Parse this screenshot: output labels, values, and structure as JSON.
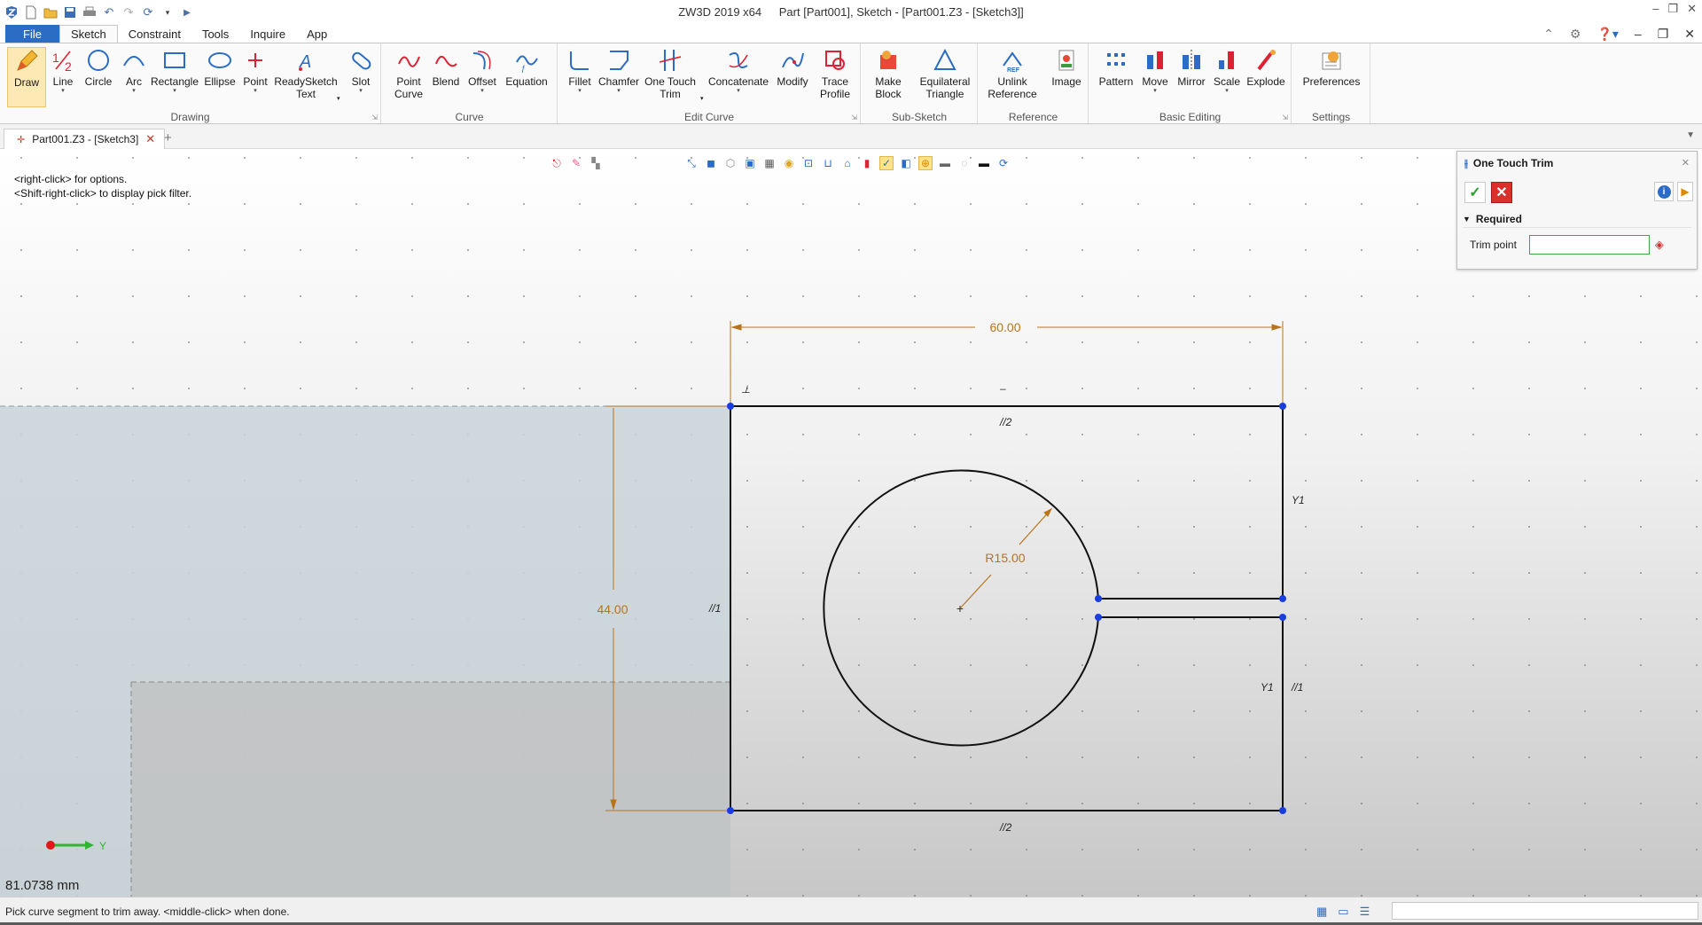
{
  "window": {
    "app_title": "ZW3D 2019  x64",
    "doc_title": "Part [Part001],  Sketch - [Part001.Z3 - [Sketch3]]"
  },
  "menu": {
    "file": "File",
    "tabs": [
      "Sketch",
      "Constraint",
      "Tools",
      "Inquire",
      "App"
    ]
  },
  "ribbon": {
    "groups": {
      "drawing": "Drawing",
      "curve": "Curve",
      "edit_curve": "Edit Curve",
      "sub_sketch": "Sub-Sketch",
      "reference": "Reference",
      "basic_editing": "Basic Editing",
      "settings": "Settings"
    },
    "buttons": {
      "draw": "Draw",
      "line": "Line",
      "circle": "Circle",
      "arc": "Arc",
      "rectangle": "Rectangle",
      "ellipse": "Ellipse",
      "point": "Point",
      "readysketch_1": "ReadySketch",
      "readysketch_2": "Text",
      "slot": "Slot",
      "point_curve_1": "Point",
      "point_curve_2": "Curve",
      "blend": "Blend",
      "offset": "Offset",
      "equation": "Equation",
      "fillet": "Fillet",
      "chamfer": "Chamfer",
      "one_touch_trim_1": "One Touch",
      "one_touch_trim_2": "Trim",
      "concatenate": "Concatenate",
      "modify": "Modify",
      "trace_profile_1": "Trace",
      "trace_profile_2": "Profile",
      "make_block_1": "Make",
      "make_block_2": "Block",
      "eq_triangle_1": "Equilateral",
      "eq_triangle_2": "Triangle",
      "unlink_ref_1": "Unlink",
      "unlink_ref_2": "Reference",
      "image": "Image",
      "pattern": "Pattern",
      "move": "Move",
      "mirror": "Mirror",
      "scale": "Scale",
      "explode": "Explode",
      "preferences": "Preferences"
    }
  },
  "doc_tab": {
    "label": "Part001.Z3 - [Sketch3]"
  },
  "viewport": {
    "hint_line1": "<right-click> for options.",
    "hint_line2": "<Shift-right-click> to display pick filter.",
    "readout": "81.0738 mm",
    "dim_width": "60.00",
    "dim_height": "44.00",
    "dim_radius": "R15.00",
    "axis_label": "Y",
    "constraint_parallel_1": "//1",
    "constraint_parallel_2": "//2",
    "constraint_tangent_1": "Y1"
  },
  "command_panel": {
    "title": "One Touch Trim",
    "section": "Required",
    "field_label": "Trim point",
    "field_value": ""
  },
  "status": {
    "prompt": "Pick curve segment to trim away.  <middle-click> when done."
  },
  "colors": {
    "accent": "#2b6cc4",
    "dimension": "#b8741a",
    "sketch_line": "#111111",
    "vertex": "#1a3de0"
  }
}
